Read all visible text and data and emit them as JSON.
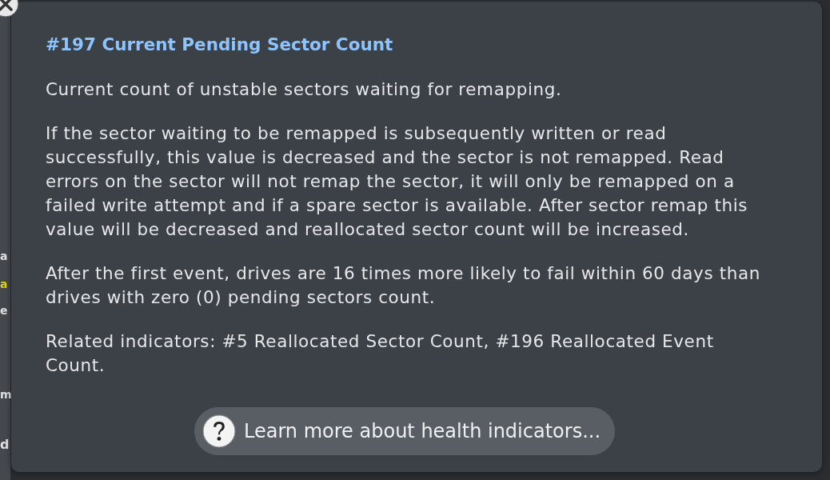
{
  "background": {
    "fragments": [
      {
        "text": "a",
        "color": "#e0e0e0"
      },
      {
        "text": "a",
        "color": "#e6d200"
      },
      {
        "text": "e",
        "color": "#e0e0e0"
      },
      {
        "text": "m",
        "color": "#e0e0e0"
      },
      {
        "text": "d",
        "color": "#e0e0e0"
      }
    ]
  },
  "popover": {
    "title": "#197 Current Pending Sector Count",
    "paragraphs": [
      "Current count of unstable sectors waiting for remapping.",
      "If the sector waiting to be remapped is subsequently written or read successfully, this value is decreased and the sector is not remapped. Read errors on the sector will not remap the sector, it will only be remapped on a failed write attempt and if a spare sector is available. After sector remap this value will be decreased and reallocated sector count will be increased.",
      "After the first event, drives are 16 times more likely to fail within 60 days than drives with zero (0) pending sectors count.",
      "Related indicators: #5 Reallocated Sector Count, #196 Reallocated Event Count."
    ],
    "button": {
      "label": "Learn more about health indicators..."
    }
  }
}
